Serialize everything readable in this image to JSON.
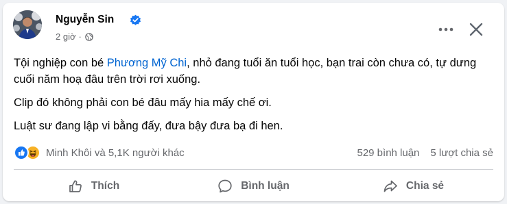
{
  "post": {
    "author": "Nguyễn Sin",
    "time": "2 giờ",
    "separator": "·",
    "paragraph_1_before": "Tội nghiệp con bé ",
    "mention": "Phương Mỹ Chi",
    "paragraph_1_after": ", nhỏ đang tuổi ăn tuổi học, bạn trai còn chưa có, tự dưng cuối năm hoạ đâu trên trời rơi xuống.",
    "paragraph_2": "Clip đó không phải con bé đâu mấy hia mấy chế ơi.",
    "paragraph_3": "Luật sư đang lập vi bằng đấy, đưa bậy đưa bạ đi hen."
  },
  "stats": {
    "reaction_summary": "Minh Khôi và 5,1K người khác",
    "comments": "529 bình luận",
    "shares": "5 lượt chia sẻ"
  },
  "actions": {
    "like": "Thích",
    "comment": "Bình luận",
    "share": "Chia sẻ"
  },
  "icons": {
    "verified": "verified-icon",
    "privacy": "globe-icon",
    "more": "more-dots-icon",
    "close": "close-icon",
    "like": "thumbs-up-icon",
    "comment": "comment-bubble-icon",
    "share": "share-arrow-icon",
    "reaction_1": "like-reaction-icon",
    "reaction_2": "haha-reaction-icon"
  },
  "colors": {
    "accent": "#1877f2",
    "mention": "#0064d1",
    "secondary_text": "#65676b"
  }
}
